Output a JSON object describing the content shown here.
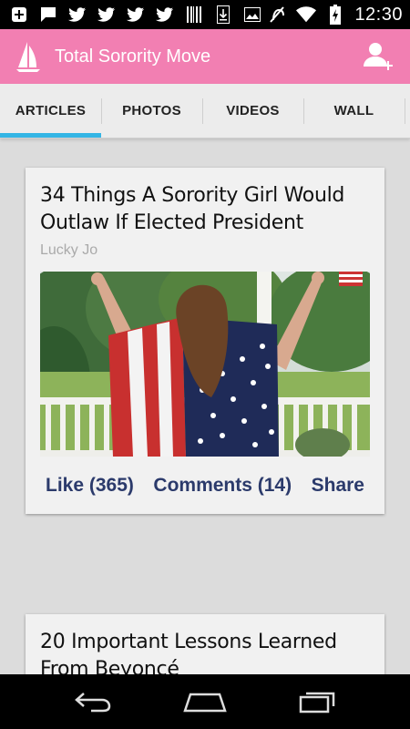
{
  "status_bar": {
    "time": "12:30",
    "left_icons": [
      "add-icon",
      "chat-icon",
      "twitter-icon",
      "twitter-icon",
      "twitter-icon",
      "twitter-icon",
      "barcode-icon",
      "download-icon",
      "image-icon"
    ],
    "right_icons": [
      "mute-icon",
      "wifi-icon",
      "battery-charging-icon"
    ]
  },
  "app_bar": {
    "title": "Total Sorority Move",
    "background": "#f27fb2"
  },
  "tabs": [
    {
      "label": "ARTICLES",
      "active": true
    },
    {
      "label": "PHOTOS",
      "active": false
    },
    {
      "label": "VIDEOS",
      "active": false
    },
    {
      "label": "WALL",
      "active": false
    }
  ],
  "accent_color": "#33b5e5",
  "articles": [
    {
      "title": "34 Things A Sorority Girl Would Outlaw If Elected President",
      "author": "Lucky Jo",
      "like_label": "Like (365)",
      "comments_label": "Comments (14)",
      "share_label": "Share"
    },
    {
      "title": "20 Important Lessons Learned From Beyoncé"
    }
  ]
}
